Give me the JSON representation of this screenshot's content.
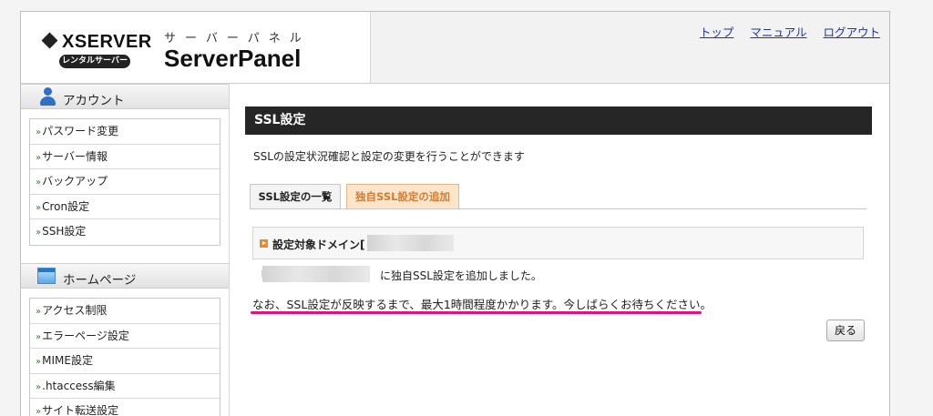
{
  "header": {
    "brand": "XSERVER",
    "rental_label": "レンタルサーバー",
    "kana": "サーバーパネル",
    "product": "ServerPanel",
    "nav": [
      "トップ",
      "マニュアル",
      "ログアウト"
    ]
  },
  "sidebar": {
    "sections": [
      {
        "title": "アカウント",
        "icon": "person-icon",
        "items": [
          "パスワード変更",
          "サーバー情報",
          "バックアップ",
          "Cron設定",
          "SSH設定"
        ]
      },
      {
        "title": "ホームページ",
        "icon": "webpage-icon",
        "items": [
          "アクセス制限",
          "エラーページ設定",
          "MIME設定",
          ".htaccess編集",
          "サイト転送設定"
        ]
      }
    ],
    "item_arrow": "»"
  },
  "main": {
    "title": "SSL設定",
    "intro": "SSLの設定状況確認と設定の変更を行うことができます",
    "tabs": [
      {
        "label": "SSL設定の一覧",
        "active": false
      },
      {
        "label": "独自SSL設定の追加",
        "active": true
      }
    ],
    "domain_label": "設定対象ドメイン[",
    "added_open": "「",
    "added_message": "に独自SSL設定を追加しました。",
    "note": "なお、SSL設定が反映するまで、最大1時間程度かかります。今しばらくお待ちください。",
    "back_label": "戻る"
  },
  "colors": {
    "title_bar": "#262626",
    "active_tab_bg": "#fde5cc",
    "active_tab_text": "#d87a2e",
    "note_underline": "#e6117f",
    "link": "#2233aa",
    "icon_blue": "#2f6fc4"
  }
}
